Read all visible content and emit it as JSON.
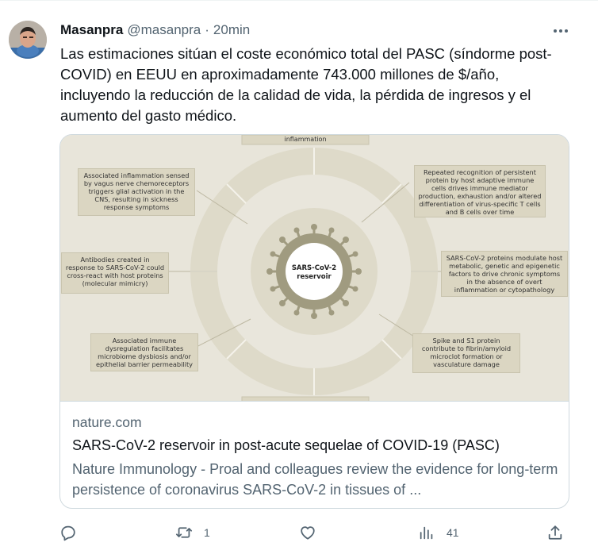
{
  "author": {
    "display_name": "Masanpra",
    "handle": "@masanpra",
    "separator": "·",
    "time": "20min"
  },
  "tweet": {
    "text": "Las estimaciones sitúan el coste económico total del PASC (síndorme post-COVID) en EEUU en aproximadamente 743.000 millones de $/año, incluyendo la reducción de la calidad de vida, la pérdida de ingresos y el aumento del gasto médico."
  },
  "card": {
    "domain": "nature.com",
    "title": "SARS-CoV-2 reservoir in post-acute sequelae of COVID-19 (PASC)",
    "description": "Nature Immunology - Proal and colleagues review the evidence for long-term persistence of coronavirus SARS-CoV-2 in tissues of ...",
    "figure": {
      "center_label_1": "SARS-CoV-2",
      "center_label_2": "reservoir",
      "top_label": "inflammation",
      "box_top_left": "Associated inflammation sensed by vagus nerve chemoreceptors triggers glial activation in the CNS, resulting in sickness response symptoms",
      "box_top_right": "Repeated recognition of persistent protein by host adaptive immune cells drives immune mediator production, exhaustion and/or altered differentiation of virus-specific T cells and B cells over time",
      "box_mid_left": "Antibodies created in response to SARS-CoV-2 could cross-react with host proteins (molecular mimicry)",
      "box_mid_right": "SARS-CoV-2 proteins modulate host metabolic, genetic and epigenetic factors to drive chronic symptoms in the absence of overt inflammation or cytopathology",
      "box_bottom_left": "Associated immune dysregulation facilitates microbiome dysbiosis and/or epithelial barrier permeability",
      "box_bottom_right": "Spike and S1 protein contribute to fibrin/amyloid microclot formation or vasculature damage"
    }
  },
  "actions": {
    "reply_count": "",
    "retweet_count": "1",
    "like_count": "",
    "views_count": "41"
  },
  "icons": [
    "avatar",
    "more-icon",
    "reply-icon",
    "retweet-icon",
    "like-icon",
    "views-icon",
    "share-icon"
  ]
}
